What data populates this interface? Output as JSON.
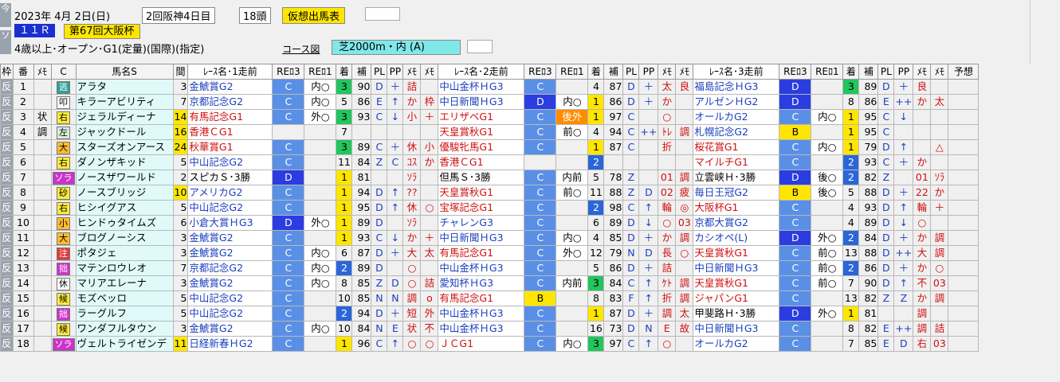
{
  "header": {
    "date": "2023年 4月 2日(日)",
    "meeting": "2回阪神4日目",
    "runners": "18頭",
    "mode_label": "仮想出馬表",
    "race_no": "１１Ｒ",
    "race_name": "第67回大阪杯",
    "conditions": "4歳以上･オープン･G1(定量)(国際)(指定)",
    "course_label": "コース図",
    "course": "芝2000m・内 (A)",
    "side_tab_1": "今",
    "side_tab_2": "ソ"
  },
  "columns": [
    "枠",
    "番",
    "ﾒﾓ",
    "C",
    "馬名S",
    "間",
    "ﾚｰｽ名･1走前",
    "REﾛ3",
    "REﾛ1",
    "着",
    "補",
    "PL",
    "PP",
    "ﾒﾓ",
    "ﾒﾓ",
    "ﾚｰｽ名･2走前",
    "REﾛ3",
    "REﾛ1",
    "着",
    "補",
    "PL",
    "PP",
    "ﾒﾓ",
    "ﾒﾓ",
    "ﾚｰｽ名･3走前",
    "REﾛ3",
    "REﾛ1",
    "着",
    "補",
    "PL",
    "PP",
    "ﾒﾓ",
    "ﾒﾓ",
    "予想"
  ],
  "rows": [
    {
      "w": "反",
      "n": "1",
      "m": "",
      "c": "逃",
      "cc": "t",
      "name": "アラタ",
      "iv": "3",
      "r1": [
        "金鯱賞G2",
        "C",
        "内○",
        "3",
        "90",
        "D",
        "＋",
        "詰",
        ""
      ],
      "r2": [
        "中山金杯ＨG3",
        "C",
        "",
        "4",
        "87",
        "D",
        "＋",
        "太",
        "良"
      ],
      "r3": [
        "福島記念ＨG3",
        "D",
        "",
        "3",
        "89",
        "D",
        "＋",
        "良",
        ""
      ]
    },
    {
      "w": "反",
      "n": "2",
      "m": "",
      "c": "叩",
      "cc": "w",
      "name": "キラーアビリティ",
      "iv": "7",
      "r1": [
        "京都記念G2",
        "C",
        "内○",
        "5",
        "86",
        "E",
        "↑",
        "か",
        "枠"
      ],
      "r2": [
        "中日新聞ＨG3",
        "D",
        "内○",
        "1",
        "86",
        "D",
        "＋",
        "か",
        ""
      ],
      "r3": [
        "アルゼンＨG2",
        "D",
        "",
        "8",
        "86",
        "E",
        "++",
        "か",
        "太"
      ]
    },
    {
      "w": "反",
      "n": "3",
      "m": "状",
      "c": "右",
      "cc": "y",
      "name": "ジェラルディーナ",
      "iv": "14",
      "r1": [
        "有馬記念G1",
        "C",
        "外○",
        "3",
        "93",
        "C",
        "↓",
        "小",
        "＋"
      ],
      "r2": [
        "エリザベG1",
        "C",
        "後外",
        "1",
        "97",
        "C",
        "",
        "○",
        ""
      ],
      "r3": [
        "オールカG2",
        "C",
        "内○",
        "1",
        "95",
        "C",
        "↓",
        "",
        ""
      ]
    },
    {
      "w": "反",
      "n": "4",
      "m": "調",
      "c": "左",
      "cc": "g",
      "name": "ジャックドール",
      "iv": "16",
      "r1": [
        "香港ＣG1",
        "",
        "",
        "7",
        "",
        "",
        "",
        "",
        ""
      ],
      "r2": [
        "天皇賞秋G1",
        "C",
        "前○",
        "4",
        "94",
        "C",
        "++",
        "ﾄﾚ",
        "調"
      ],
      "r3": [
        "札幌記念G2",
        "B",
        "",
        "1",
        "95",
        "C",
        "",
        "",
        ""
      ]
    },
    {
      "w": "反",
      "n": "5",
      "m": "",
      "c": "大",
      "cc": "o",
      "name": "スターズオンアース",
      "iv": "24",
      "r1": [
        "秋華賞G1",
        "C",
        "",
        "3",
        "89",
        "C",
        "＋",
        "休",
        "小"
      ],
      "r2": [
        "優駿牝馬G1",
        "C",
        "",
        "1",
        "87",
        "C",
        "",
        "折",
        ""
      ],
      "r3": [
        "桜花賞G1",
        "C",
        "内○",
        "1",
        "79",
        "D",
        "↑",
        "",
        "△"
      ]
    },
    {
      "w": "反",
      "n": "6",
      "m": "",
      "c": "右",
      "cc": "y",
      "name": "ダノンザキッド",
      "iv": "5",
      "r1": [
        "中山記念G2",
        "C",
        "",
        "11",
        "84",
        "Z",
        "C",
        "ｺｽ",
        "か"
      ],
      "r2": [
        "香港ＣG1",
        "",
        "",
        "2",
        "",
        "",
        "",
        "",
        ""
      ],
      "r3": [
        "マイルチG1",
        "C",
        "",
        "2",
        "93",
        "C",
        "＋",
        "か",
        ""
      ]
    },
    {
      "w": "反",
      "n": "7",
      "m": "",
      "c": "ソラ",
      "cc": "p",
      "name": "ノースザワールド",
      "iv": "2",
      "r1": [
        "スピカＳ･3勝",
        "D",
        "",
        "1",
        "81",
        "",
        "",
        "ｿﾗ",
        ""
      ],
      "r2": [
        "但馬Ｓ･3勝",
        "C",
        "内前",
        "5",
        "78",
        "Z",
        "",
        "01",
        "調"
      ],
      "r3": [
        "立雲峡Ｈ･3勝",
        "D",
        "後○",
        "2",
        "82",
        "Z",
        "",
        "01",
        "ｿﾗ"
      ]
    },
    {
      "w": "反",
      "n": "8",
      "m": "",
      "c": "砂",
      "cc": "y",
      "name": "ノースブリッジ",
      "iv": "10",
      "r1": [
        "アメリカG2",
        "C",
        "",
        "1",
        "94",
        "D",
        "↑",
        "??",
        ""
      ],
      "r2": [
        "天皇賞秋G1",
        "C",
        "前○",
        "11",
        "88",
        "Z",
        "D",
        "02",
        "疲"
      ],
      "r3": [
        "毎日王冠G2",
        "B",
        "後○",
        "5",
        "88",
        "D",
        "＋",
        "22",
        "か"
      ]
    },
    {
      "w": "反",
      "n": "9",
      "m": "",
      "c": "右",
      "cc": "y",
      "name": "ヒシイグアス",
      "iv": "5",
      "r1": [
        "中山記念G2",
        "C",
        "",
        "1",
        "95",
        "D",
        "↑",
        "休",
        "○"
      ],
      "r2": [
        "宝塚記念G1",
        "C",
        "",
        "2",
        "98",
        "C",
        "↑",
        "輪",
        "◎"
      ],
      "r3": [
        "大阪杯G1",
        "C",
        "",
        "4",
        "93",
        "D",
        "↑",
        "輪",
        "＋"
      ]
    },
    {
      "w": "反",
      "n": "10",
      "m": "",
      "c": "小",
      "cc": "o",
      "name": "ヒンドゥタイムズ",
      "iv": "6",
      "r1": [
        "小倉大賞ＨG3",
        "D",
        "外○",
        "1",
        "89",
        "D",
        "",
        "ｿﾗ",
        ""
      ],
      "r2": [
        "チャレンG3",
        "C",
        "",
        "6",
        "89",
        "D",
        "↓",
        "○",
        "03"
      ],
      "r3": [
        "京都大賞G2",
        "C",
        "",
        "4",
        "89",
        "D",
        "↓",
        "○",
        ""
      ]
    },
    {
      "w": "反",
      "n": "11",
      "m": "",
      "c": "大",
      "cc": "o",
      "name": "ブログノーシス",
      "iv": "3",
      "r1": [
        "金鯱賞G2",
        "C",
        "",
        "1",
        "93",
        "C",
        "↓",
        "か",
        "＋"
      ],
      "r2": [
        "中日新聞ＨG3",
        "C",
        "内○",
        "4",
        "85",
        "D",
        "＋",
        "か",
        "調"
      ],
      "r3": [
        "カシオペ(L)",
        "D",
        "外○",
        "2",
        "84",
        "D",
        "＋",
        "か",
        "調"
      ]
    },
    {
      "w": "反",
      "n": "12",
      "m": "",
      "c": "注",
      "cc": "r",
      "name": "ポタジェ",
      "iv": "3",
      "r1": [
        "金鯱賞G2",
        "C",
        "内○",
        "6",
        "87",
        "D",
        "＋",
        "大",
        "太"
      ],
      "r2": [
        "有馬記念G1",
        "C",
        "外○",
        "12",
        "79",
        "N",
        "D",
        "長",
        "○"
      ],
      "r3": [
        "天皇賞秋G1",
        "C",
        "前○",
        "13",
        "88",
        "D",
        "++",
        "大",
        "調"
      ]
    },
    {
      "w": "反",
      "n": "13",
      "m": "",
      "c": "拙",
      "cc": "p",
      "name": "マテンロウレオ",
      "iv": "7",
      "r1": [
        "京都記念G2",
        "C",
        "内○",
        "2",
        "89",
        "D",
        "",
        "○",
        ""
      ],
      "r2": [
        "中山金杯ＨG3",
        "C",
        "",
        "5",
        "86",
        "D",
        "＋",
        "詰",
        ""
      ],
      "r3": [
        "中日新聞ＨG3",
        "C",
        "前○",
        "2",
        "86",
        "D",
        "＋",
        "か",
        "○"
      ]
    },
    {
      "w": "反",
      "n": "14",
      "m": "",
      "c": "休",
      "cc": "w",
      "name": "マリアエレーナ",
      "iv": "3",
      "r1": [
        "金鯱賞G2",
        "C",
        "内○",
        "8",
        "85",
        "Z",
        "D",
        "○",
        "詰"
      ],
      "r2": [
        "愛知杯ＨG3",
        "C",
        "内前",
        "3",
        "84",
        "C",
        "↑",
        "ｹﾄ",
        "調"
      ],
      "r3": [
        "天皇賞秋G1",
        "C",
        "前○",
        "7",
        "90",
        "D",
        "↑",
        "不",
        "03"
      ]
    },
    {
      "w": "反",
      "n": "15",
      "m": "",
      "c": "候",
      "cc": "y",
      "name": "モズベッロ",
      "iv": "5",
      "r1": [
        "中山記念G2",
        "C",
        "",
        "10",
        "85",
        "N",
        "N",
        "調",
        "o"
      ],
      "r2": [
        "有馬記念G1",
        "B",
        "",
        "8",
        "83",
        "F",
        "↑",
        "折",
        "調"
      ],
      "r3": [
        "ジャパンG1",
        "C",
        "",
        "13",
        "82",
        "Z",
        "Z",
        "か",
        "調"
      ]
    },
    {
      "w": "反",
      "n": "16",
      "m": "",
      "c": "拙",
      "cc": "p",
      "name": "ラーグルフ",
      "iv": "5",
      "r1": [
        "中山記念G2",
        "C",
        "",
        "2",
        "94",
        "D",
        "＋",
        "短",
        "外"
      ],
      "r2": [
        "中山金杯ＨG3",
        "C",
        "",
        "1",
        "87",
        "D",
        "＋",
        "調",
        "太"
      ],
      "r3": [
        "甲斐路Ｈ･3勝",
        "D",
        "外○",
        "1",
        "81",
        "",
        "",
        "調",
        ""
      ]
    },
    {
      "w": "反",
      "n": "17",
      "m": "",
      "c": "候",
      "cc": "y",
      "name": "ワンダフルタウン",
      "iv": "3",
      "r1": [
        "金鯱賞G2",
        "C",
        "内○",
        "10",
        "84",
        "N",
        "E",
        "状",
        "不"
      ],
      "r2": [
        "中山金杯ＨG3",
        "C",
        "",
        "16",
        "73",
        "D",
        "N",
        "E",
        "故"
      ],
      "r3": [
        "中日新聞ＨG3",
        "C",
        "",
        "8",
        "82",
        "E",
        "++",
        "調",
        "詰"
      ]
    },
    {
      "w": "反",
      "n": "18",
      "m": "",
      "c": "ソラ",
      "cc": "p",
      "name": "ヴェルトライゼンデ",
      "iv": "11",
      "r1": [
        "日経新春ＨG2",
        "C",
        "",
        "1",
        "96",
        "C",
        "↑",
        "○",
        "○"
      ],
      "r2": [
        "ＪＣG1",
        "C",
        "内○",
        "3",
        "97",
        "C",
        "↑",
        "○",
        ""
      ],
      "r3": [
        "オールカG2",
        "C",
        "",
        "7",
        "85",
        "E",
        "D",
        "右",
        "03"
      ]
    }
  ],
  "colors": {
    "rank_blue": "#2b66d9",
    "rank_green": "#22c55e",
    "rank_yellow": "#ffe600",
    "name_bg": "#e0fafa",
    "iv_yellow": "#ffe600"
  }
}
